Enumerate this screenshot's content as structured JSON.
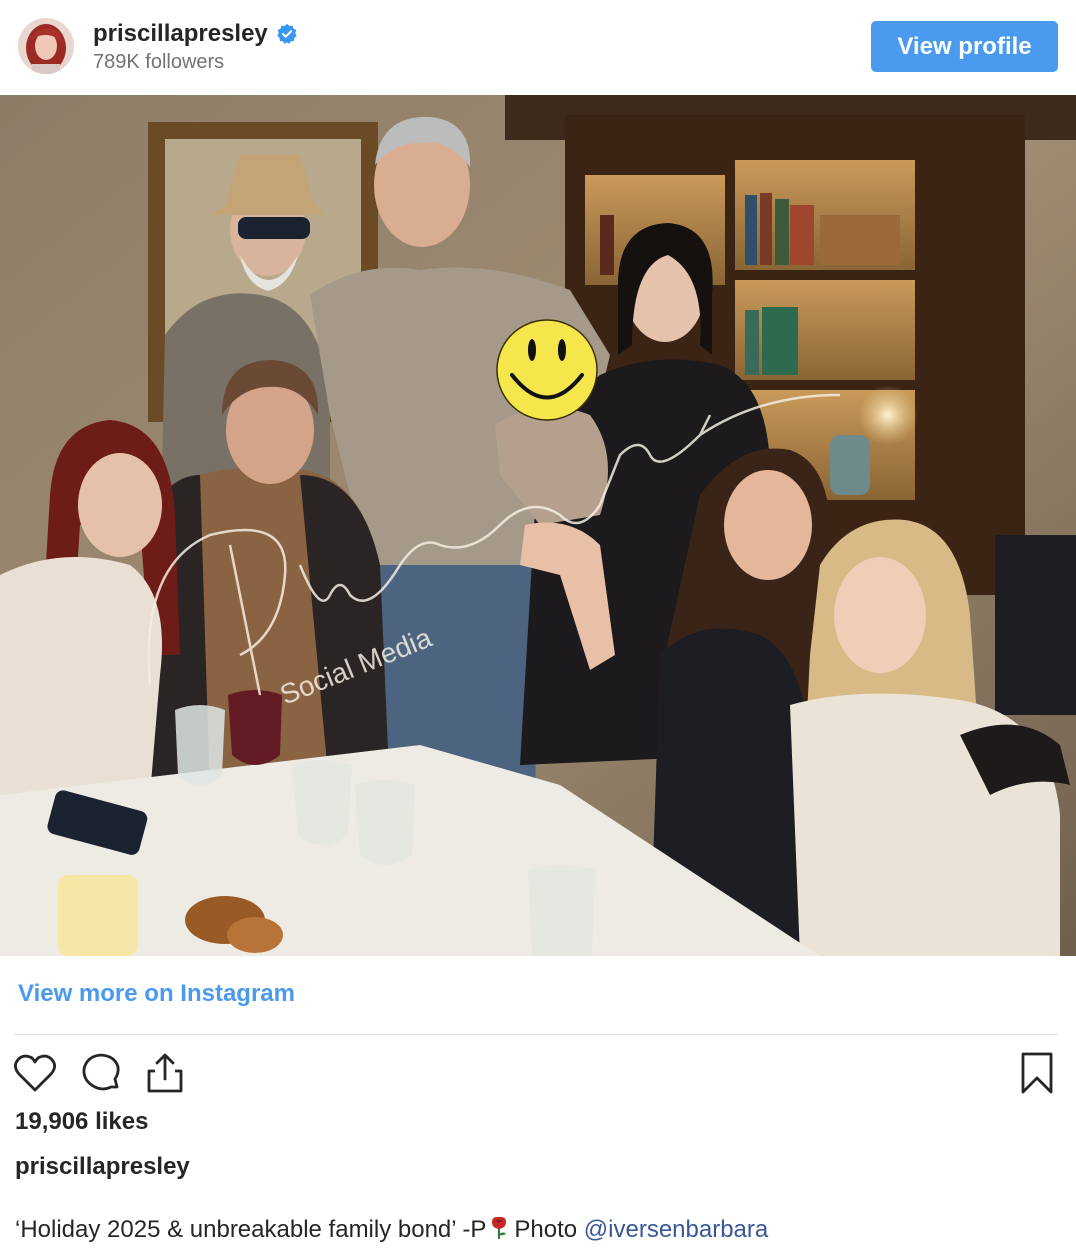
{
  "header": {
    "username": "priscillapresley",
    "followers": "789K followers",
    "view_profile_label": "View profile",
    "verified_color": "#3897f0",
    "avatar_icon": "profile-avatar"
  },
  "post": {
    "watermark_signature": "Priscilla Presley",
    "watermark_text": "Social Media"
  },
  "view_more_label": "View more on Instagram",
  "actions": {
    "like_icon": "heart-icon",
    "comment_icon": "comment-icon",
    "share_icon": "share-icon",
    "save_icon": "bookmark-icon"
  },
  "likes": "19,906 likes",
  "author": "priscillapresley",
  "caption": {
    "text": "‘Holiday 2025 & unbreakable family bond’ -P",
    "emoji": "rose",
    "photo_label": "Photo",
    "mention": "@iversenbarbara"
  },
  "colors": {
    "accent": "#4a9af0",
    "mention": "#385898"
  }
}
